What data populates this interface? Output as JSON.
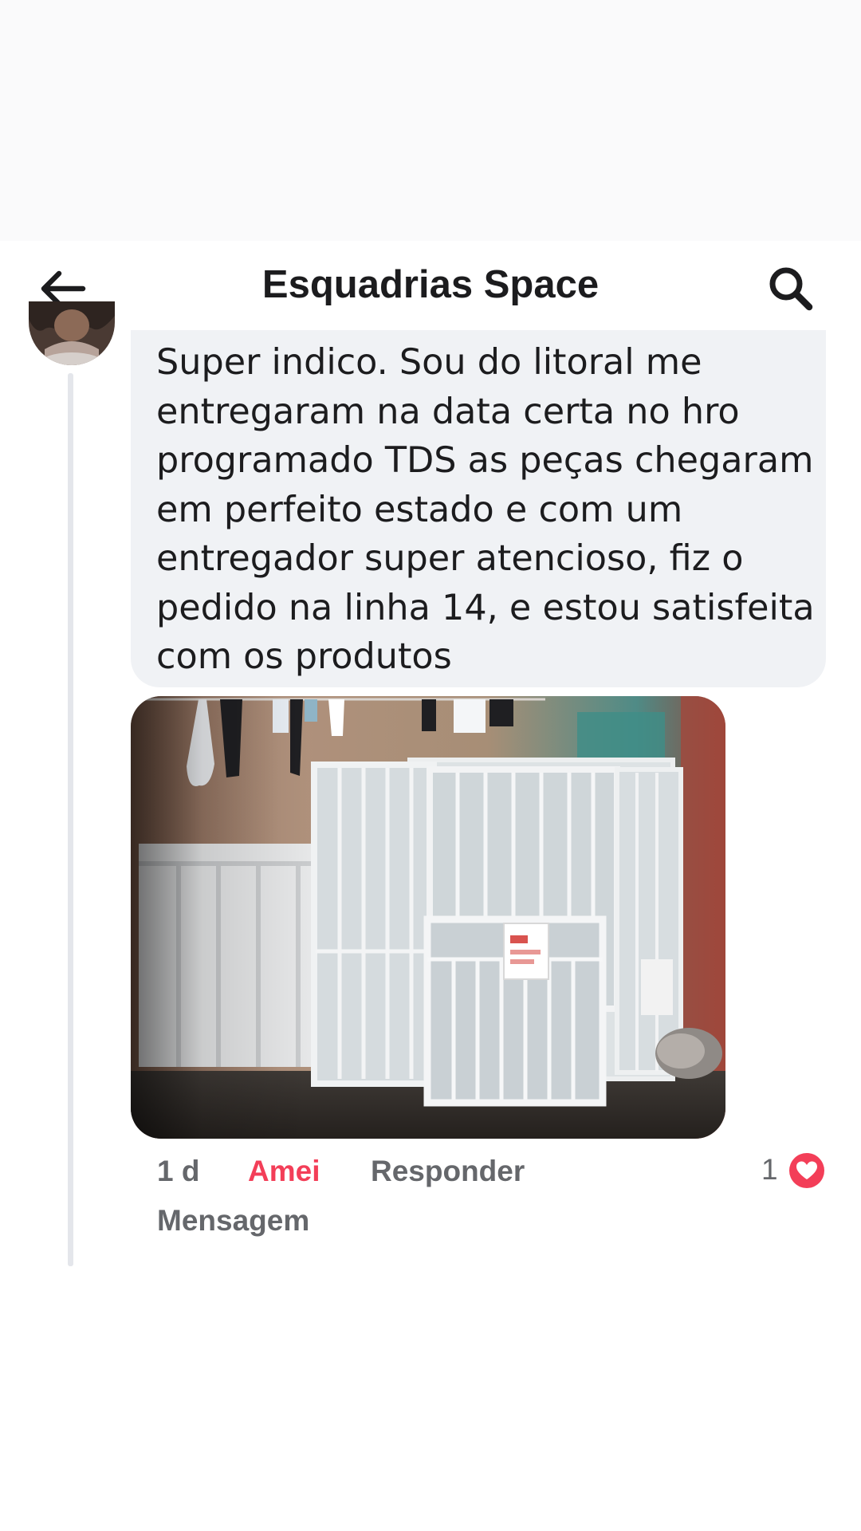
{
  "header": {
    "title": "Esquadrias Space",
    "back_icon": "arrow-left-icon",
    "search_icon": "search-icon"
  },
  "comment": {
    "text": "Super indico. Sou do litoral me entregaram na data certa no hro programado TDS as peças chegaram em perfeito estado e com um entregador super atencioso, fiz o pedido na linha 14, e estou satisfeita com os produtos",
    "time": "1 d",
    "reaction_label": "Amei",
    "reply_label": "Responder",
    "message_label": "Mensagem",
    "reaction_count": "1",
    "reaction_icon": "heart-icon"
  },
  "colors": {
    "reaction_accent": "#f33e58",
    "secondary_text": "#65676b",
    "bubble_background": "#f0f2f5",
    "primary_text": "#1c1c1e"
  }
}
